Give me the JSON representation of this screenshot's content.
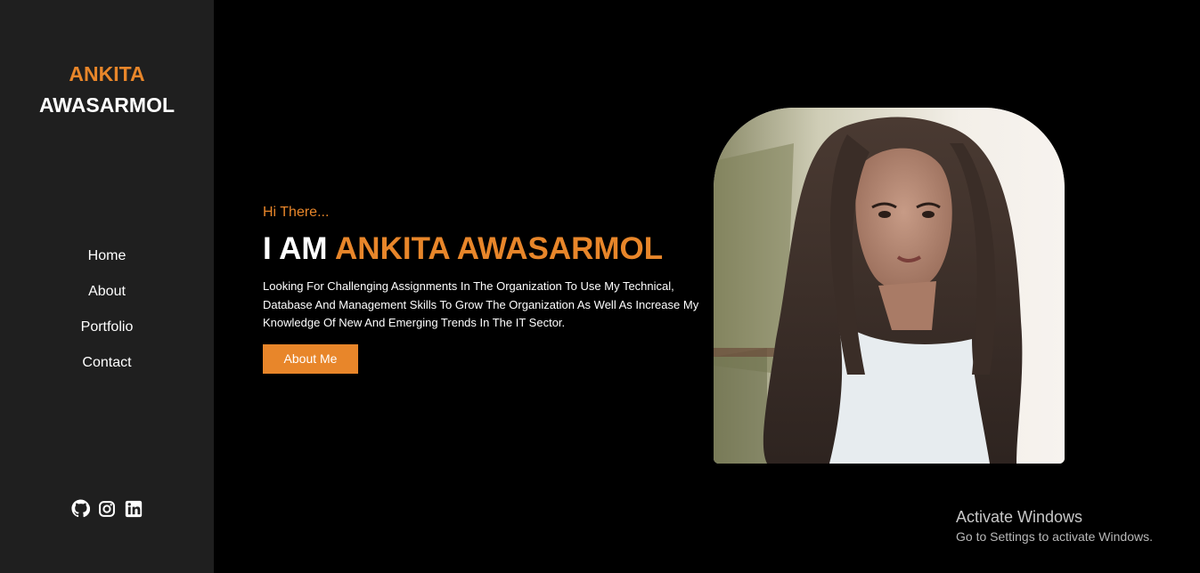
{
  "sidebar": {
    "brand_first": "ANKITA",
    "brand_last": "AWASARMOL",
    "nav": [
      {
        "label": "Home"
      },
      {
        "label": "About"
      },
      {
        "label": "Portfolio"
      },
      {
        "label": "Contact"
      }
    ],
    "socials": [
      "github-icon",
      "instagram-icon",
      "linkedin-icon"
    ]
  },
  "hero": {
    "greeting": "Hi There...",
    "headline_prefix": "I AM ",
    "headline_name": "ANKITA AWASARMOL",
    "description": "Looking For Challenging Assignments In The Organization To Use My Technical, Database And Management Skills To Grow The Organization As Well As Increase My Knowledge Of New And Emerging Trends In The IT Sector.",
    "button_label": "About Me"
  },
  "os_overlay": {
    "title": "Activate Windows",
    "subtitle": "Go to Settings to activate Windows."
  },
  "colors": {
    "accent": "#e8862a",
    "sidebar_bg": "#1f1f1f",
    "page_bg": "#000000"
  }
}
